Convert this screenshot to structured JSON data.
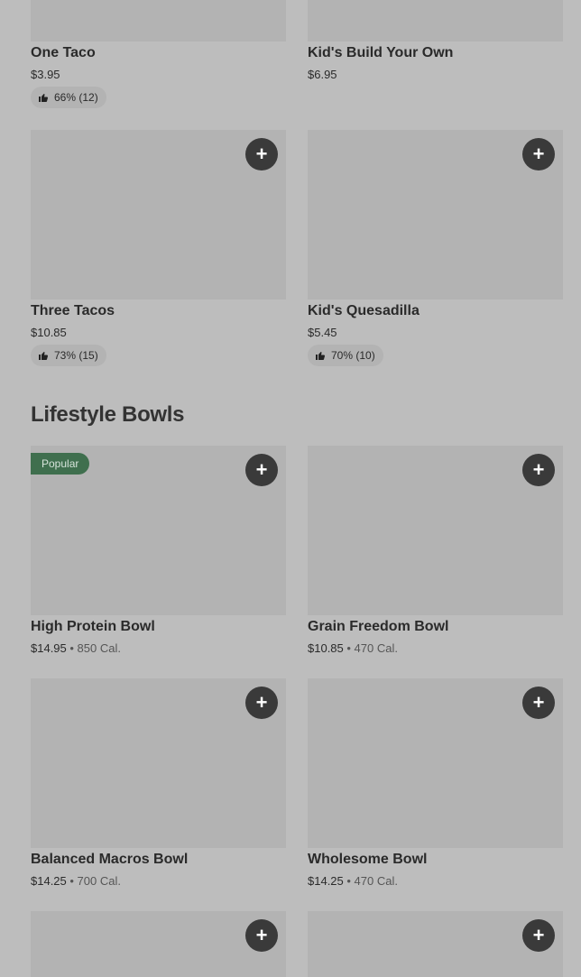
{
  "items": {
    "one_taco": {
      "name": "One Taco",
      "price": "$3.95",
      "rating": "66% (12)"
    },
    "kids_build": {
      "name": "Kid's Build Your Own",
      "price": "$6.95"
    },
    "three_tacos": {
      "name": "Three Tacos",
      "price": "$10.85",
      "rating": "73% (15)"
    },
    "kids_quesadilla": {
      "name": "Kid's Quesadilla",
      "price": "$5.45",
      "rating": "70% (10)"
    }
  },
  "section": {
    "title": "Lifestyle Bowls"
  },
  "bowls": {
    "high_protein": {
      "badge": "Popular",
      "name": "High Protein Bowl",
      "price": "$14.95",
      "sep": " • ",
      "cal": "850 Cal."
    },
    "grain_freedom": {
      "name": "Grain Freedom Bowl",
      "price": "$10.85",
      "sep": " • ",
      "cal": "470 Cal."
    },
    "balanced_macros": {
      "name": "Balanced Macros Bowl",
      "price": "$14.25",
      "sep": " • ",
      "cal": "700 Cal."
    },
    "wholesome": {
      "name": "Wholesome Bowl",
      "price": "$14.25",
      "sep": " • ",
      "cal": "470 Cal."
    }
  },
  "add_symbol": "+",
  "colors": {
    "page_bg": "#bdbdbd",
    "image_placeholder": "#b3b3b3",
    "add_button": "#3a3a3a",
    "badge": "#3f6f4e"
  },
  "icons": {
    "add": "plus-icon",
    "rating": "thumbs-up-icon"
  }
}
